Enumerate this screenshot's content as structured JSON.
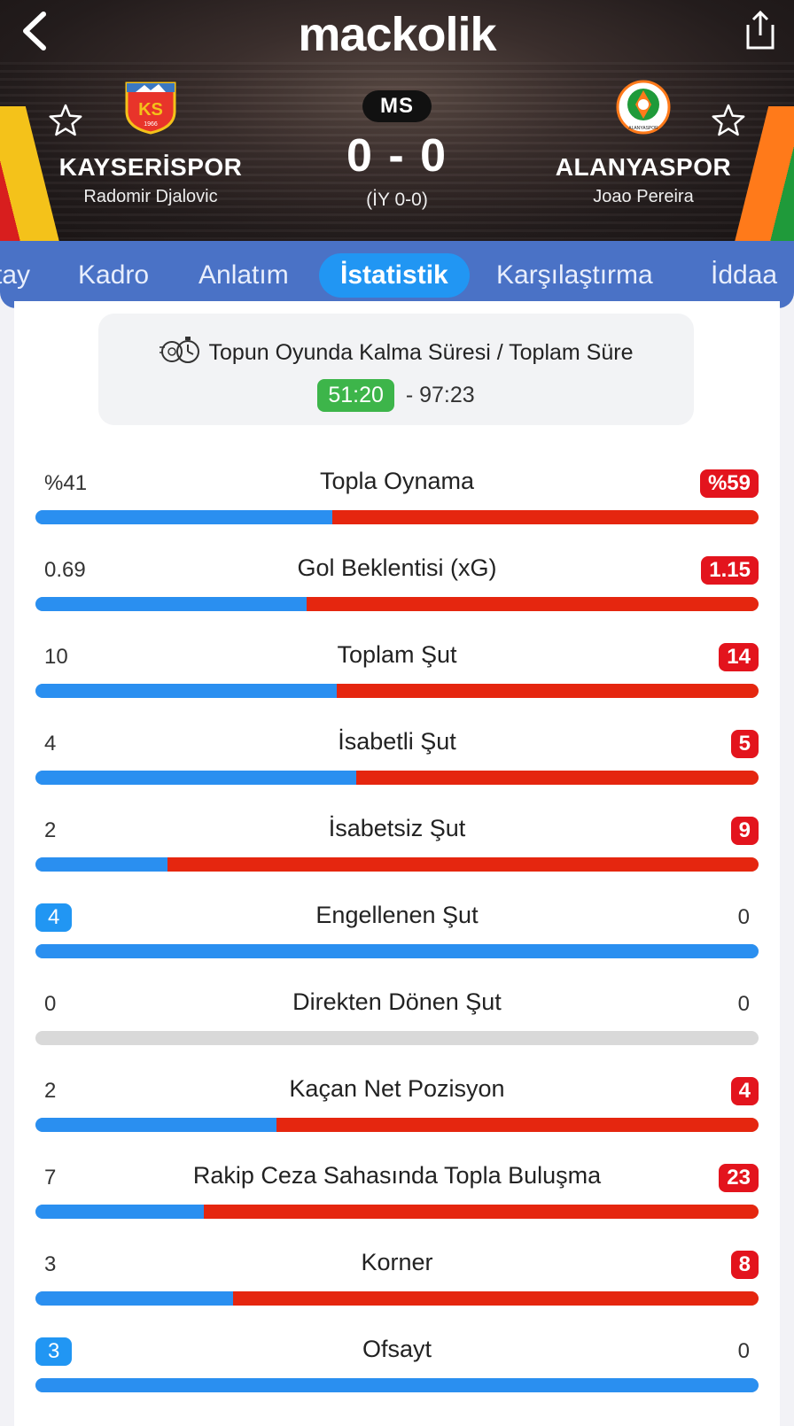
{
  "brand": "mackolik",
  "match": {
    "status": "MS",
    "score": "0 - 0",
    "halftime": "(İY 0-0)",
    "home": {
      "name": "KAYSERİSPOR",
      "coach": "Radomir Djalovic",
      "logo_text": "KS",
      "logo_year": "1966"
    },
    "away": {
      "name": "ALANYASPOR",
      "coach": "Joao Pereira",
      "logo_text": "ALANYASPOR"
    }
  },
  "tabs": [
    {
      "label": "tay"
    },
    {
      "label": "Kadro"
    },
    {
      "label": "Anlatım"
    },
    {
      "label": "İstatistik",
      "active": true
    },
    {
      "label": "Karşılaştırma"
    },
    {
      "label": "İddaa"
    }
  ],
  "possession_time": {
    "title": "Topun Oyunda Kalma Süresi / Toplam Süre",
    "in_play": "51:20",
    "total": "- 97:23"
  },
  "stats": [
    {
      "label": "Topla Oynama",
      "home": "%41",
      "away": "%59",
      "home_share": 0.41,
      "leader": "away"
    },
    {
      "label": "Gol Beklentisi (xG)",
      "home": "0.69",
      "away": "1.15",
      "home_share": 0.375,
      "leader": "away"
    },
    {
      "label": "Toplam Şut",
      "home": "10",
      "away": "14",
      "home_share": 0.417,
      "leader": "away"
    },
    {
      "label": "İsabetli Şut",
      "home": "4",
      "away": "5",
      "home_share": 0.444,
      "leader": "away"
    },
    {
      "label": "İsabetsiz Şut",
      "home": "2",
      "away": "9",
      "home_share": 0.182,
      "leader": "away"
    },
    {
      "label": "Engellenen Şut",
      "home": "4",
      "away": "0",
      "home_share": 1.0,
      "leader": "home"
    },
    {
      "label": "Direkten Dönen Şut",
      "home": "0",
      "away": "0",
      "home_share": null,
      "leader": "none"
    },
    {
      "label": "Kaçan Net Pozisyon",
      "home": "2",
      "away": "4",
      "home_share": 0.333,
      "leader": "away"
    },
    {
      "label": "Rakip Ceza Sahasında Topla Buluşma",
      "home": "7",
      "away": "23",
      "home_share": 0.233,
      "leader": "away"
    },
    {
      "label": "Korner",
      "home": "3",
      "away": "8",
      "home_share": 0.273,
      "leader": "away"
    },
    {
      "label": "Ofsayt",
      "home": "3",
      "away": "0",
      "home_share": 1.0,
      "leader": "home"
    }
  ],
  "colors": {
    "home_bar": "#2a8ff0",
    "away_bar": "#e5260f",
    "tab_bar": "#4a72c6",
    "active_tab": "#2196f3",
    "time_badge": "#3db54a"
  }
}
